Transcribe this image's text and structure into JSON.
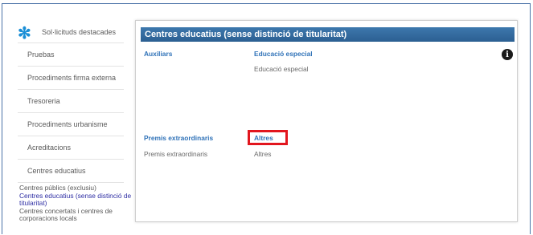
{
  "sidebar": {
    "items": [
      {
        "label": "Sol·licituds destacades"
      },
      {
        "label": "Pruebas"
      },
      {
        "label": "Procediments firma externa"
      },
      {
        "label": "Tresoreria"
      },
      {
        "label": "Procediments urbanisme"
      },
      {
        "label": "Acreditacions"
      },
      {
        "label": "Centres educatius"
      }
    ],
    "sub_items": [
      {
        "label": "Centres públics (exclusiu)"
      },
      {
        "label": "Centres educatius (sense distinció de titularitat)"
      },
      {
        "label": "Centres concertats i centres de corporacions locals"
      }
    ],
    "accent_color": "#1b8fd6"
  },
  "panel": {
    "title": "Centres educatius (sense distinció de titularitat)",
    "header_color": "#2f6aa0",
    "rows": [
      {
        "category": "Auxiliars",
        "link": "Educació especial",
        "item": "Educació especial"
      },
      {
        "category": "Premis extraordinaris",
        "link": "Altres",
        "category_item": "Premis extraordinaris",
        "item": "Altres"
      }
    ],
    "highlight_color": "#e2161e"
  }
}
